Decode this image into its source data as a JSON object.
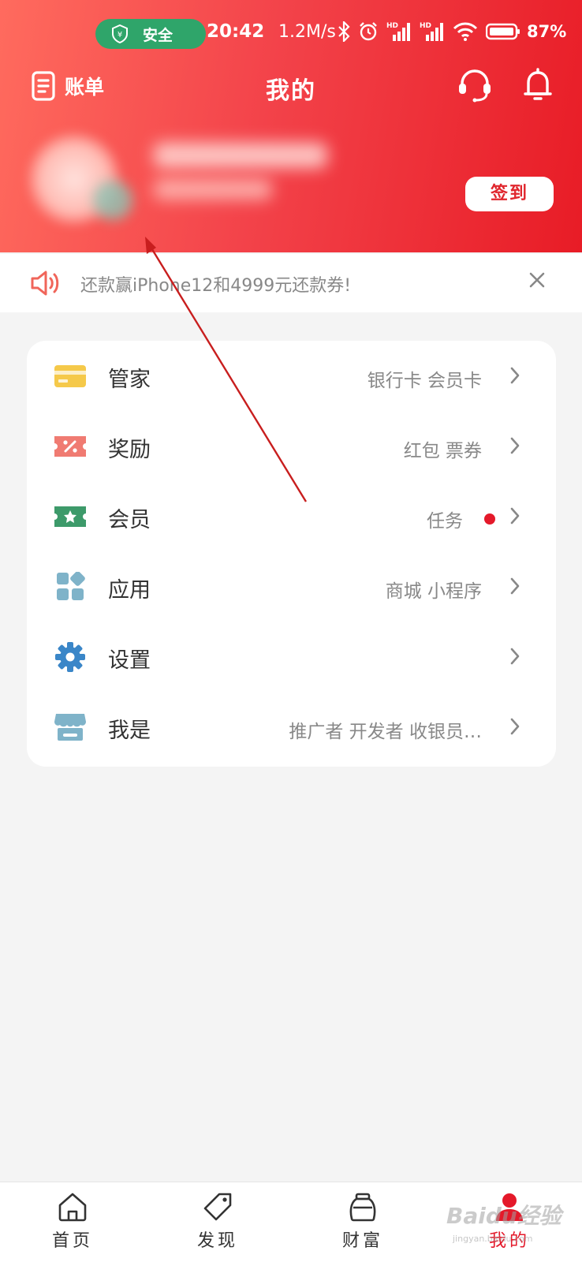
{
  "status_bar": {
    "safety_label": "安全",
    "time": "20:42",
    "net_speed": "1.2M/s",
    "battery_percent": "87%"
  },
  "header": {
    "bill_label": "账单",
    "title": "我的",
    "signin_label": "签到"
  },
  "notice": {
    "text": "还款赢iPhone12和4999元还款券!"
  },
  "menu": [
    {
      "label": "管家",
      "right": "银行卡 会员卡",
      "icon": "card-icon"
    },
    {
      "label": "奖励",
      "right": "红包 票券",
      "icon": "coupon-icon"
    },
    {
      "label": "会员",
      "right": "任务",
      "icon": "member-ticket-icon",
      "has_dot": true
    },
    {
      "label": "应用",
      "right": "商城 小程序",
      "icon": "apps-grid-icon"
    },
    {
      "label": "设置",
      "right": "",
      "icon": "gear-icon"
    },
    {
      "label": "我是",
      "right": "推广者 开发者 收银员…",
      "icon": "store-icon"
    }
  ],
  "tabbar": [
    {
      "label": "首页",
      "icon": "home-icon"
    },
    {
      "label": "发现",
      "icon": "tag-icon"
    },
    {
      "label": "财富",
      "icon": "jar-icon"
    },
    {
      "label": "我的",
      "icon": "user-icon",
      "active": true
    }
  ],
  "watermark": {
    "text": "Baidu经验",
    "sub": "jingyan.baidu.com"
  },
  "colors": {
    "brand_red": "#e4192a",
    "header_gradient_start": "#ff6b5e",
    "header_gradient_end": "#e81c26",
    "safe_green": "#2fa56a"
  }
}
